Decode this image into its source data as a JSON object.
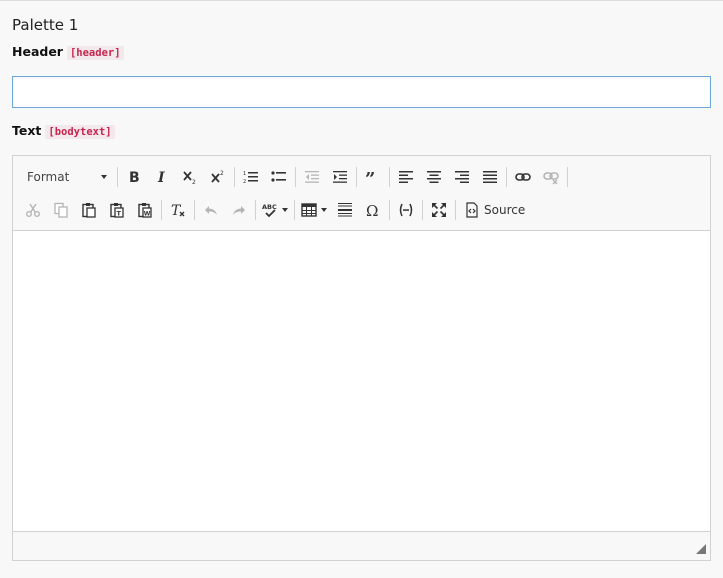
{
  "palette": {
    "title": "Palette 1"
  },
  "header_field": {
    "label": "Header",
    "code": "[header]",
    "value": ""
  },
  "text_field": {
    "label": "Text",
    "code": "[bodytext]"
  },
  "toolbar": {
    "format_label": "Format",
    "source_label": "Source",
    "icons": [
      "bold-icon",
      "italic-icon",
      "subscript-icon",
      "superscript-icon",
      "numbered-list-icon",
      "bullet-list-icon",
      "outdent-icon",
      "indent-icon",
      "blockquote-icon",
      "align-left-icon",
      "align-center-icon",
      "align-right-icon",
      "justify-icon",
      "link-icon",
      "unlink-icon",
      "cut-icon",
      "copy-icon",
      "paste-icon",
      "paste-text-icon",
      "paste-word-icon",
      "remove-format-icon",
      "undo-icon",
      "redo-icon",
      "spellcheck-icon",
      "table-icon",
      "horizontal-rule-icon",
      "special-char-icon",
      "soft-hyphen-icon",
      "maximize-icon",
      "source-icon"
    ]
  },
  "colors": {
    "accent": "#6da7d9",
    "code_text": "#c7254e"
  }
}
